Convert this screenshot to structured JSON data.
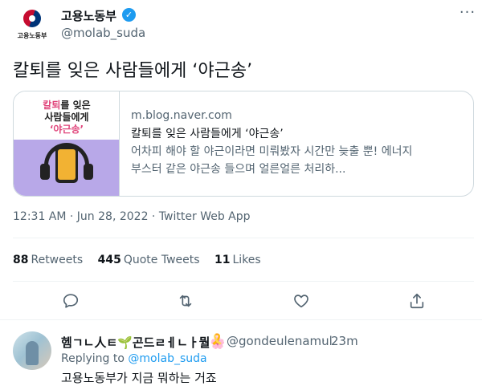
{
  "account": {
    "display_name": "고용노동부",
    "handle": "@molab_suda",
    "avatar_text": "고용노동부"
  },
  "tweet": {
    "text": "칼퇴를 잊은 사람들에게 ‘야근송’",
    "meta": "12:31 AM · Jun 28, 2022 · Twitter Web App"
  },
  "card": {
    "thumb_line1_pink": "칼퇴",
    "thumb_line1": "를 잊은",
    "thumb_line2": "사람들에게",
    "thumb_line3": "‘야근송’",
    "domain": "m.blog.naver.com",
    "title": "칼퇴를 잊은 사람들에게 ‘야근송’",
    "desc_line1": "어차피 해야 할 야근이라면 미뤄봤자 시간만 늦출 뿐! 에너지",
    "desc_line2": "부스터 같은 야근송 들으며 얼른얼른 처리하..."
  },
  "stats": {
    "retweets_count": "88",
    "retweets_label": "Retweets",
    "quotes_count": "445",
    "quotes_label": "Quote Tweets",
    "likes_count": "11",
    "likes_label": "Likes"
  },
  "actions": [
    "reply-icon",
    "retweet-icon",
    "like-icon",
    "share-icon"
  ],
  "reply": {
    "name": "헴ㄱㄴ人ㅌ🌱곤드ㄹㅔㄴㅏ뭘🌸",
    "badge": "🎗️",
    "handle": "@gondeulenamul",
    "dot": "·",
    "time": "23m",
    "replying_prefix": "Replying to",
    "replying_to": "@molab_suda",
    "text": "고용노동부가 지금 뭐하는 거죠"
  },
  "colors": {
    "accent": "#1d9bf0",
    "secondary_text": "#536471",
    "border": "#cfd9de"
  }
}
